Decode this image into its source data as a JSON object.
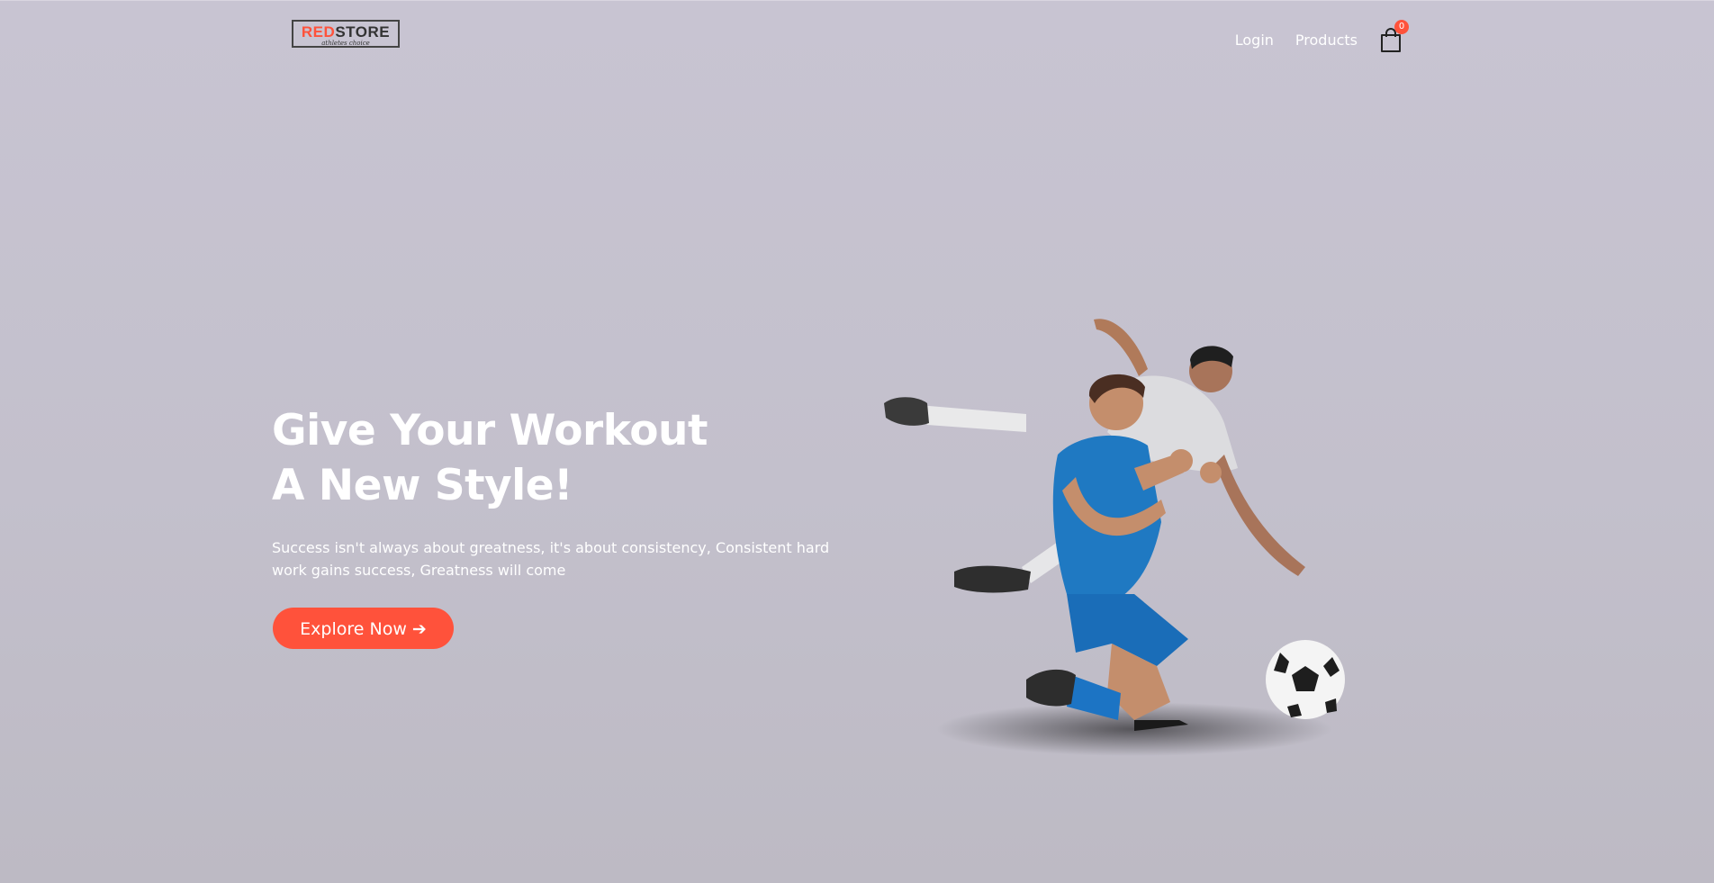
{
  "brand": {
    "logo_part1": "RED",
    "logo_part2": "STORE",
    "tagline": "athletes choice",
    "accent_color": "#ff523b"
  },
  "nav": {
    "items": [
      {
        "label": "Login"
      },
      {
        "label": "Products"
      }
    ],
    "cart_icon": "shopping-bag-icon",
    "cart_count": "0"
  },
  "hero": {
    "title_line1": "Give Your Workout",
    "title_line2": "A New Style!",
    "subtitle": "Success isn't always about greatness, it's about consistency, Consistent hard work gains success, Greatness will come",
    "button_label": "Explore Now ➔"
  }
}
